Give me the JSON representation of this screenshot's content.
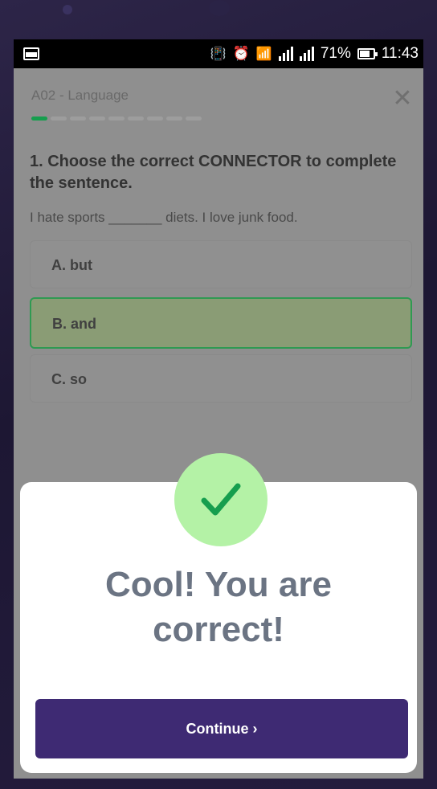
{
  "status_bar": {
    "battery_percent": "71%",
    "time": "11:43",
    "icons": [
      "notification-icon",
      "vibrate-icon",
      "alarm-icon",
      "wifi-icon",
      "signal-icon",
      "battery-icon"
    ]
  },
  "quiz": {
    "section_label": "A02 - Language",
    "progress": {
      "current": 1,
      "total": 9
    },
    "question": "1. Choose the correct CONNECTOR to complete the sentence.",
    "sentence": "I hate sports _______ diets. I love junk food.",
    "options": [
      {
        "label": "A. but",
        "state": "default"
      },
      {
        "label": "B. and",
        "state": "correct"
      },
      {
        "label": "C. so",
        "state": "default"
      }
    ]
  },
  "result_modal": {
    "icon": "checkmark-icon",
    "title_line1": "Cool! You are",
    "title_line2": "correct!",
    "continue_label": "Continue ›"
  },
  "colors": {
    "accent_green": "#169e4e",
    "correct_badge_bg": "#b4f2a6",
    "button_purple": "#3e2a73",
    "title_gray": "#6b7483"
  }
}
